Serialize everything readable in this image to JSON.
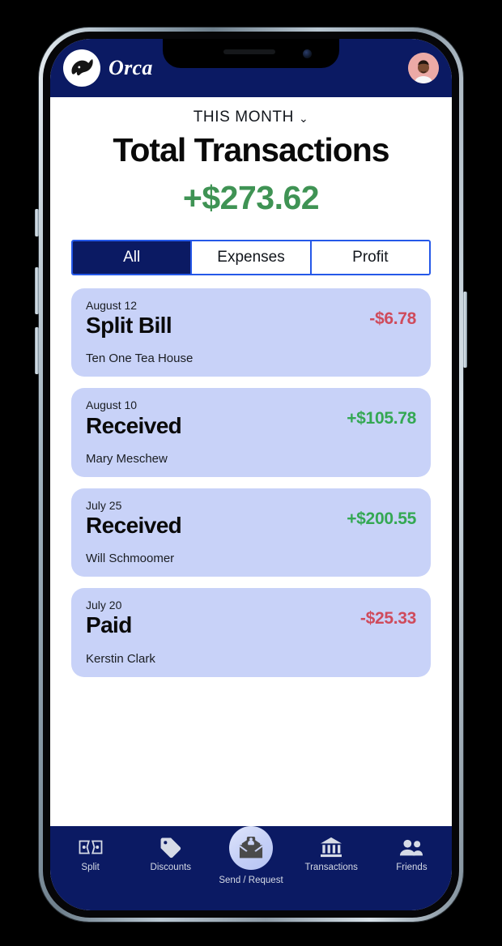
{
  "app": {
    "name": "Orca",
    "logo_icon": "orca-whale-icon",
    "avatar_icon": "user-avatar-photo"
  },
  "header": {
    "brand_label": "Orca"
  },
  "summary": {
    "period_label": "THIS MONTH",
    "period_chevron_icon": "chevron-down-icon",
    "title": "Total Transactions",
    "amount": "+$273.62",
    "amount_color": "#3f9354"
  },
  "filters": {
    "tabs": [
      {
        "label": "All",
        "active": true
      },
      {
        "label": "Expenses",
        "active": false
      },
      {
        "label": "Profit",
        "active": false
      }
    ],
    "accent_color": "#2558e8",
    "active_bg": "#0b1a63"
  },
  "transactions": [
    {
      "date": "August 12",
      "type": "Split Bill",
      "amount": "-$6.78",
      "sign": "negative",
      "counterparty": "Ten One Tea House"
    },
    {
      "date": "August 10",
      "type": "Received",
      "amount": "+$105.78",
      "sign": "positive",
      "counterparty": "Mary Meschew"
    },
    {
      "date": "July 25",
      "type": "Received",
      "amount": "+$200.55",
      "sign": "positive",
      "counterparty": "Will Schmoomer"
    },
    {
      "date": "July 20",
      "type": "Paid",
      "amount": "-$25.33",
      "sign": "negative",
      "counterparty": "Kerstin Clark"
    }
  ],
  "bottom_nav": {
    "items": [
      {
        "label": "Split",
        "icon": "split-bills-icon"
      },
      {
        "label": "Discounts",
        "icon": "price-tag-icon"
      },
      {
        "label": "Send / Request",
        "icon": "envelope-person-icon"
      },
      {
        "label": "Transactions",
        "icon": "bank-icon"
      },
      {
        "label": "Friends",
        "icon": "people-icon"
      }
    ]
  },
  "colors": {
    "navy": "#0b1a63",
    "card_bg": "#c8d2f8",
    "positive": "#34a853",
    "negative": "#cf4b5c",
    "accent_blue": "#2558e8"
  }
}
